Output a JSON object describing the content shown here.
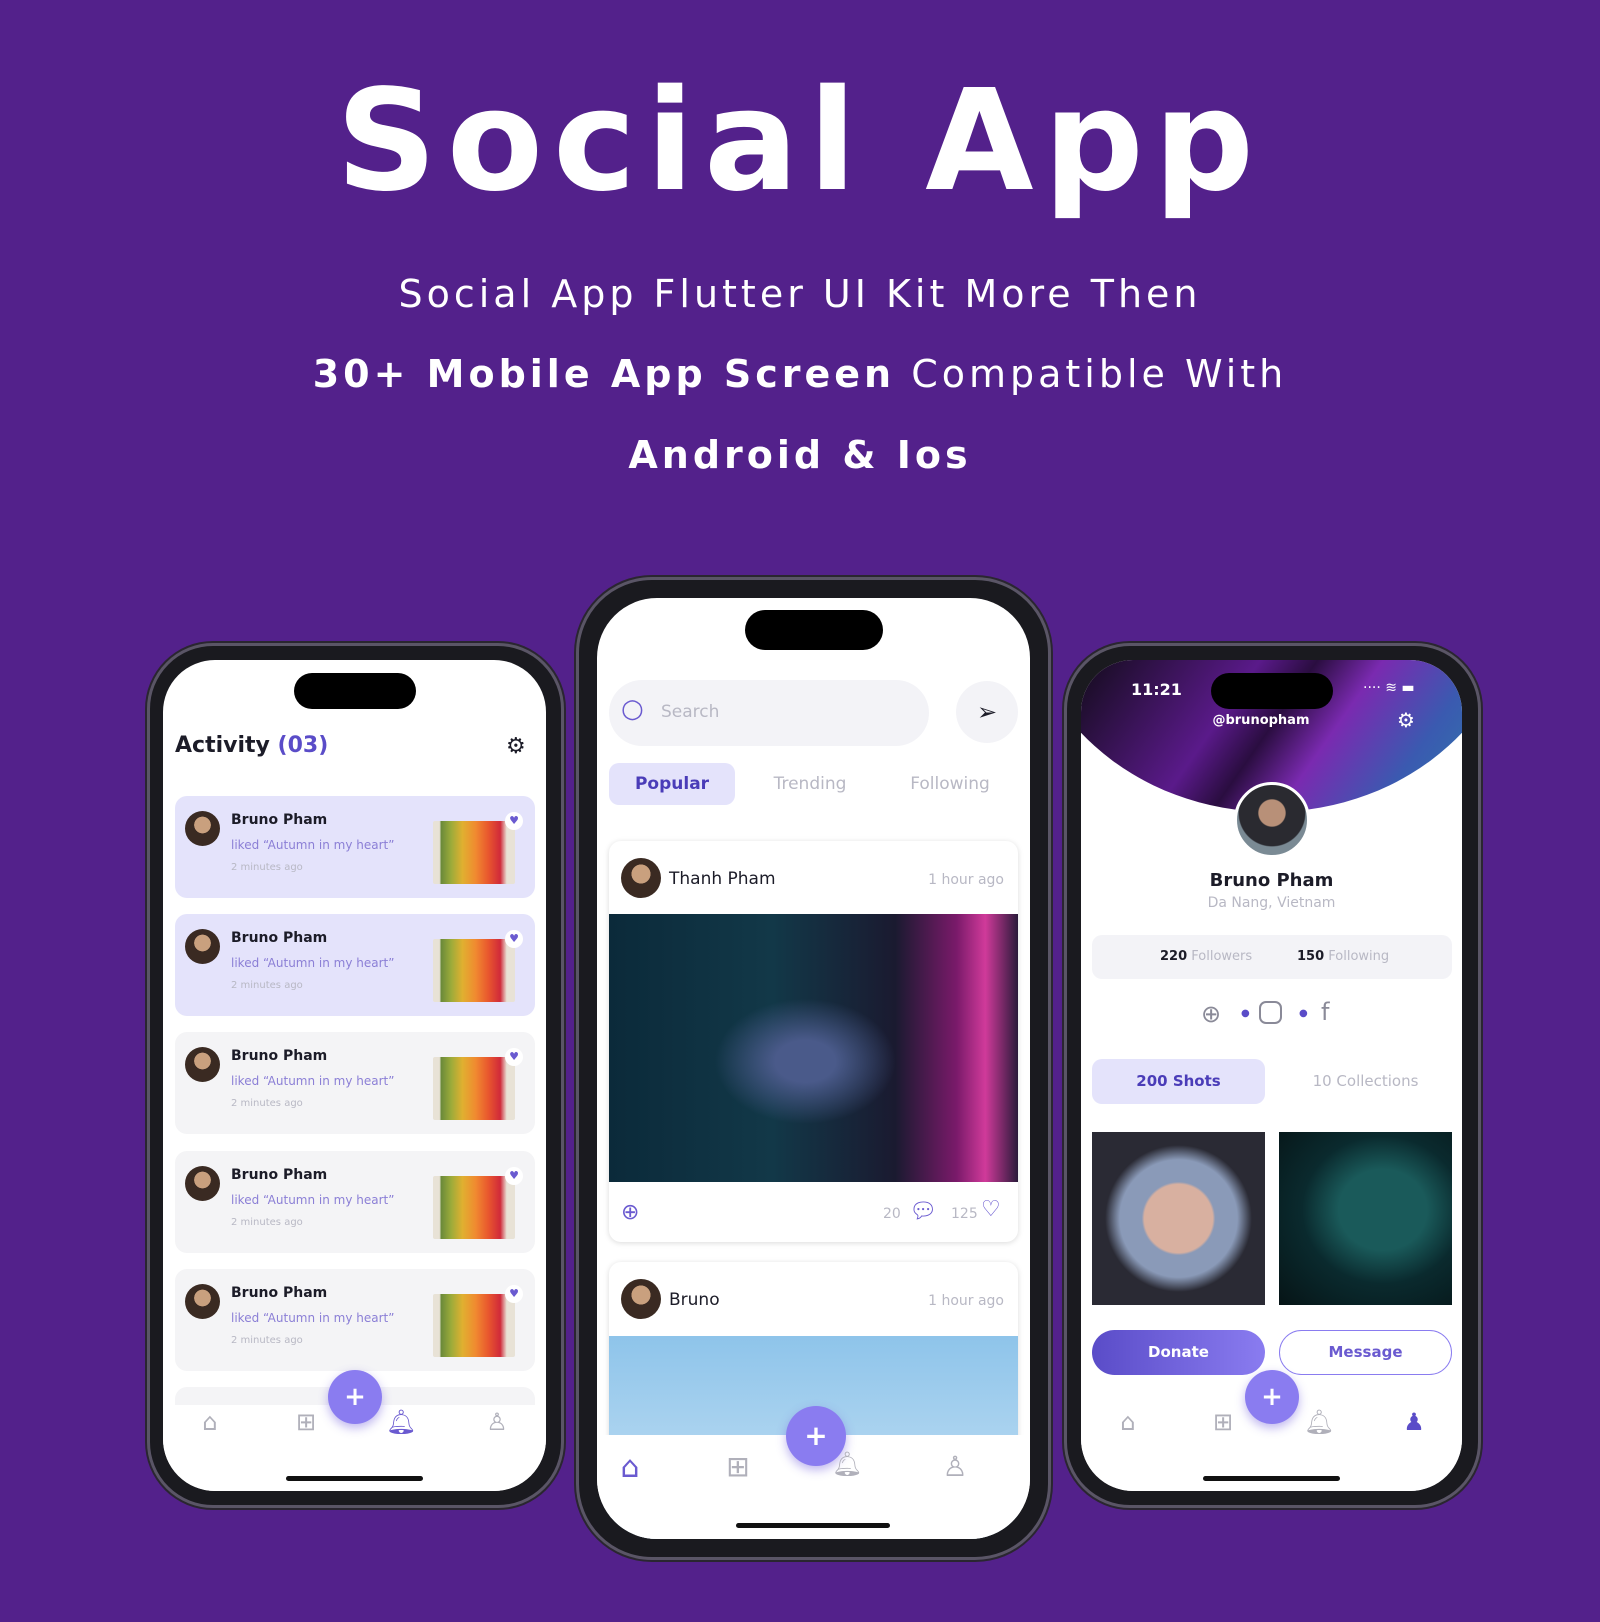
{
  "hero": {
    "title": "Social App",
    "line1": "Social App Flutter UI Kit More Then",
    "line2_bold": "30+ Mobile App Screen",
    "line2_rest": " Compatible With",
    "line3": "Android & Ios"
  },
  "colors": {
    "background": "#53218b",
    "accent": "#6a5ad0",
    "fab": "#8a7cf0",
    "tab_active_bg": "#e4e3fb"
  },
  "activity": {
    "title": "Activity",
    "count": "(03)",
    "items": [
      {
        "name": "Bruno Pham",
        "action": "liked “Autumn in my heart”",
        "time": "2 minutes ago",
        "highlighted": true
      },
      {
        "name": "Bruno Pham",
        "action": "liked “Autumn in my heart”",
        "time": "2 minutes ago",
        "highlighted": true
      },
      {
        "name": "Bruno Pham",
        "action": "liked “Autumn in my heart”",
        "time": "2 minutes ago",
        "highlighted": false
      },
      {
        "name": "Bruno Pham",
        "action": "liked “Autumn in my heart”",
        "time": "2 minutes ago",
        "highlighted": false
      },
      {
        "name": "Bruno Pham",
        "action": "liked “Autumn in my heart”",
        "time": "2 minutes ago",
        "highlighted": false
      }
    ]
  },
  "feed": {
    "search_placeholder": "Search",
    "tabs": [
      "Popular",
      "Trending",
      "Following"
    ],
    "active_tab": "Popular",
    "posts": [
      {
        "author": "Thanh Pham",
        "time": "1 hour ago",
        "comments": "20",
        "likes": "125"
      },
      {
        "author": "Bruno",
        "time": "1 hour ago"
      }
    ]
  },
  "profile": {
    "status_time": "11:21",
    "handle": "@brunopham",
    "name": "Bruno Pham",
    "location": "Da Nang, Vietnam",
    "followers_count": "220",
    "followers_label": "Followers",
    "following_count": "150",
    "following_label": "Following",
    "tabs": [
      "200 Shots",
      "10 Collections"
    ],
    "donate": "Donate",
    "message": "Message"
  },
  "nav": {
    "icons": [
      "home-icon",
      "grid-icon",
      "bell-icon",
      "user-icon"
    ],
    "fab": "+"
  }
}
